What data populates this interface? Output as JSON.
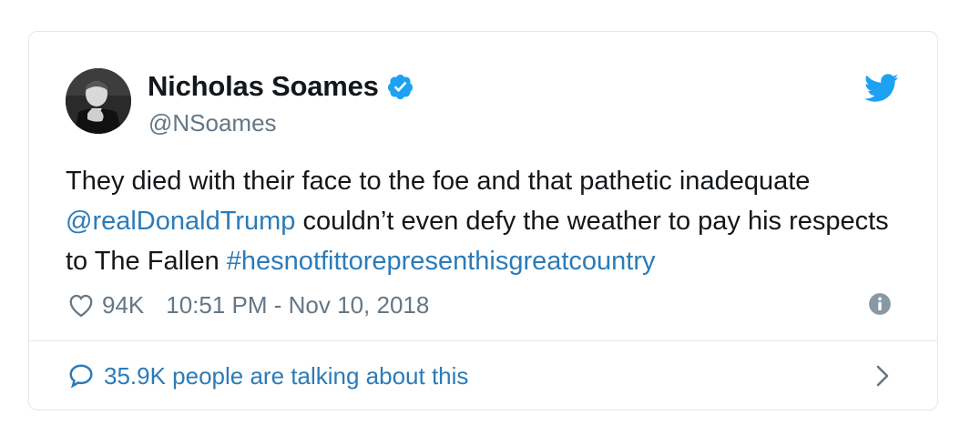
{
  "author": {
    "name": "Nicholas Soames",
    "handle": "@NSoames",
    "verified": true
  },
  "tweet": {
    "segments": [
      {
        "text": "They died with their face to the foe and that pathetic inadequate ",
        "type": "text"
      },
      {
        "text": "@realDonaldTrump",
        "type": "mention"
      },
      {
        "text": " couldn’t even defy the weather to pay his respects to The Fallen ",
        "type": "text"
      },
      {
        "text": "#hesnotfittorepresenthisgreatcountry",
        "type": "hashtag"
      }
    ]
  },
  "meta": {
    "likes": "94K",
    "timestamp": "10:51 PM - Nov 10, 2018"
  },
  "footer": {
    "talking": "35.9K people are talking about this"
  },
  "icons": {
    "verified": "verified-badge-icon",
    "bird": "twitter-bird-icon",
    "heart": "heart-icon",
    "info": "info-icon",
    "bubble": "speech-bubble-icon",
    "chevron": "chevron-right-icon"
  },
  "colors": {
    "link": "#2b7bb9",
    "twitter_blue": "#1da1f2",
    "secondary_text": "#657786",
    "border": "#e1e8ed"
  }
}
